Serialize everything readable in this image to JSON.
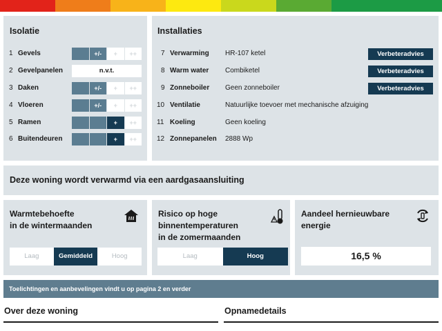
{
  "energy_band": {
    "colors": [
      "#e2231a",
      "#ef7d1a",
      "#f8b319",
      "#fde910",
      "#cad81c",
      "#5aaa33",
      "#1c9b45",
      "#1c9b45"
    ]
  },
  "isolatie": {
    "title": "Isolatie",
    "items": [
      {
        "num": "1",
        "label": "Gevels",
        "segments": [
          "",
          "+/-",
          "+",
          "++"
        ],
        "filled": 2,
        "dark": false
      },
      {
        "num": "2",
        "label": "Gevelpanelen",
        "value": "n.v.t."
      },
      {
        "num": "3",
        "label": "Daken",
        "segments": [
          "",
          "+/-",
          "+",
          "++"
        ],
        "filled": 2,
        "dark": false
      },
      {
        "num": "4",
        "label": "Vloeren",
        "segments": [
          "",
          "+/-",
          "+",
          "++"
        ],
        "filled": 2,
        "dark": false
      },
      {
        "num": "5",
        "label": "Ramen",
        "segments": [
          "",
          "",
          "+",
          "++"
        ],
        "filled": 3,
        "dark": true
      },
      {
        "num": "6",
        "label": "Buitendeuren",
        "segments": [
          "",
          "",
          "+",
          "++"
        ],
        "filled": 3,
        "dark": true
      }
    ]
  },
  "installaties": {
    "title": "Installaties",
    "items": [
      {
        "num": "7",
        "label": "Verwarming",
        "value": "HR-107 ketel",
        "button": "Verbeteradvies"
      },
      {
        "num": "8",
        "label": "Warm water",
        "value": "Combiketel",
        "button": "Verbeteradvies"
      },
      {
        "num": "9",
        "label": "Zonneboiler",
        "value": "Geen zonneboiler",
        "button": "Verbeteradvies"
      },
      {
        "num": "10",
        "label": "Ventilatie",
        "value": "Natuurlijke toevoer met mechanische afzuiging"
      },
      {
        "num": "11",
        "label": "Koeling",
        "value": "Geen koeling"
      },
      {
        "num": "12",
        "label": "Zonnepanelen",
        "value": "2888 Wp"
      }
    ]
  },
  "heating": {
    "text": "Deze woning wordt verwarmd via een aardgasaansluiting"
  },
  "cards": {
    "warmte": {
      "title_line1": "Warmtebehoefte",
      "title_line2": "in de wintermaanden",
      "levels": [
        "Laag",
        "Gemiddeld",
        "Hoog"
      ],
      "icon": "house-heat-icon"
    },
    "risico": {
      "title_line1": "Risico op hoge",
      "title_line2": "binnentemperaturen",
      "title_line3": "in de zomermaanden",
      "levels": [
        "Laag",
        "Hoog"
      ],
      "icon": "thermometer-warning-icon"
    },
    "aandeel": {
      "title_line1": "Aandeel hernieuwbare",
      "title_line2": "energie",
      "value": "16,5 %",
      "icon": "renewable-recycle-icon"
    }
  },
  "note": {
    "text": "Toelichtingen en aanbevelingen vindt u op pagina 2 en verder"
  },
  "footer": {
    "left_title": "Over deze woning",
    "right_title": "Opnamedetails"
  }
}
